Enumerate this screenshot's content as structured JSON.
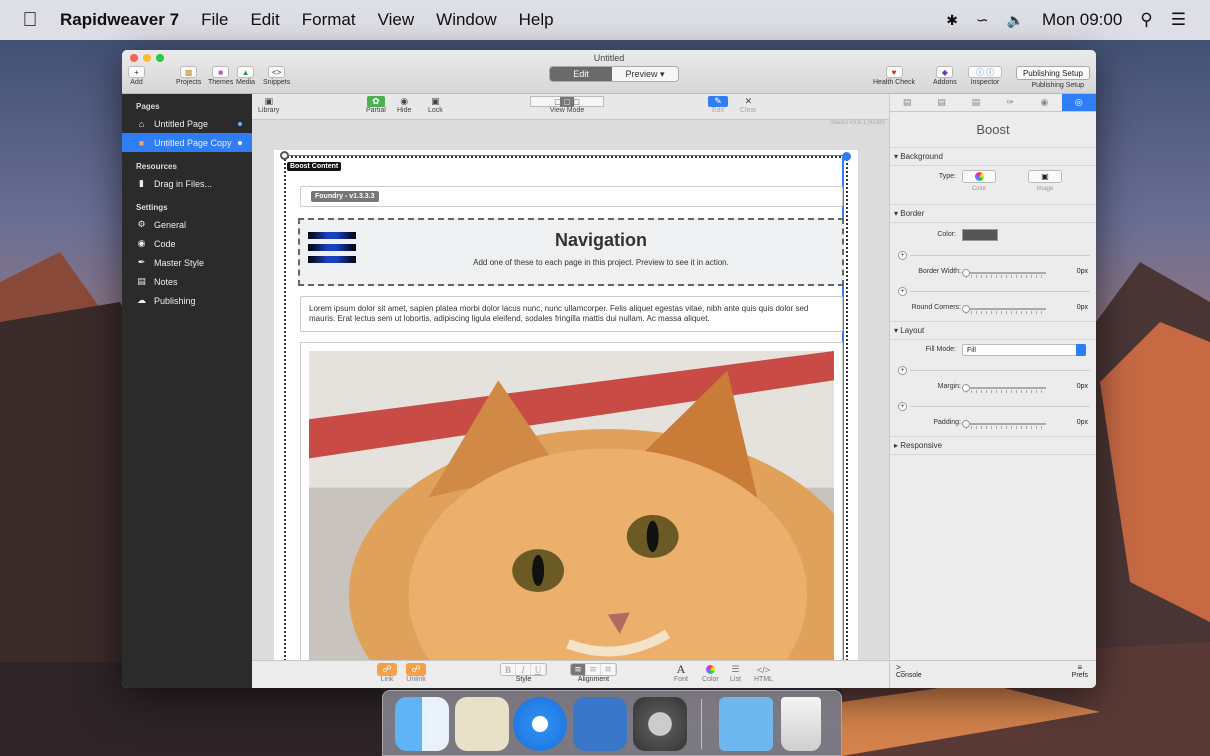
{
  "menubar": {
    "app_name": "Rapidweaver 7",
    "items": [
      "File",
      "Edit",
      "Format",
      "View",
      "Window",
      "Help"
    ],
    "clock": "Mon 09:00"
  },
  "window": {
    "title": "Untitled",
    "toolbar": {
      "add": "Add",
      "projects": "Projects",
      "themes": "Themes",
      "media": "Media",
      "snippets": "Snippets",
      "edit": "Edit",
      "preview": "Preview",
      "health_check": "Health Check",
      "addons": "Addons",
      "inspector": "Inspector",
      "publishing_setup": "Publishing Setup"
    }
  },
  "sidebar": {
    "pages_header": "Pages",
    "pages": [
      {
        "label": "Untitled Page"
      },
      {
        "label": "Untitled Page Copy"
      }
    ],
    "resources_header": "Resources",
    "resources": [
      {
        "label": "Drag in Files..."
      }
    ],
    "settings_header": "Settings",
    "settings": [
      {
        "label": "General"
      },
      {
        "label": "Code"
      },
      {
        "label": "Master Style"
      },
      {
        "label": "Notes"
      },
      {
        "label": "Publishing"
      }
    ]
  },
  "subtoolbar": {
    "library": "Library",
    "partial": "Partial",
    "hide": "Hide",
    "lock": "Lock",
    "view_mode": "View Mode",
    "edit": "Edit",
    "clear": "Clear",
    "stacks_version": "Stacks v3.6.1 (4160)"
  },
  "canvas": {
    "boost_label": "Boost Content",
    "foundry_label": "Foundry - v1.3.3.3",
    "nav_title": "Navigation",
    "nav_subtitle": "Add one of these to each page in this project. Preview to see it in action.",
    "lorem": "Lorem ipsum dolor sit amet, sapien platea morbi dolor lacus nunc, nunc ullamcorper. Felis aliquet egestas vitae, nibh ante quis quis dolor sed mauris. Erat lectus sem ut lobortis, adipiscing ligula eleifend, sodales fringilla mattis dui nullam. Ac massa aliquet."
  },
  "bottombar": {
    "link": "Link",
    "unlink": "Unlink",
    "style": "Style",
    "alignment": "Alignment",
    "font": "Font",
    "color": "Color",
    "list": "List",
    "html": "HTML",
    "bold": "B",
    "italic": "I",
    "underline": "U",
    "font_glyph": "A",
    "html_glyph": "</>"
  },
  "inspector": {
    "title": "Boost",
    "background_section": "Background",
    "type_label": "Type:",
    "type_color": "Color",
    "type_image": "Image",
    "border_section": "Border",
    "color_label": "Color:",
    "border_width_label": "Border Width:",
    "border_width_value": "0px",
    "round_corners_label": "Round Corners:",
    "round_corners_value": "0px",
    "layout_section": "Layout",
    "fill_mode_label": "Fill Mode:",
    "fill_mode_value": "Fill",
    "margin_label": "Margin:",
    "margin_value": "0px",
    "padding_label": "Padding:",
    "padding_value": "0px",
    "responsive_section": "Responsive",
    "console": "Console",
    "prefs": "Prefs"
  },
  "colors": {
    "accent": "#2f7ef7",
    "sidebar_bg": "#2b2b2b",
    "link_orange": "#f5a04a"
  }
}
